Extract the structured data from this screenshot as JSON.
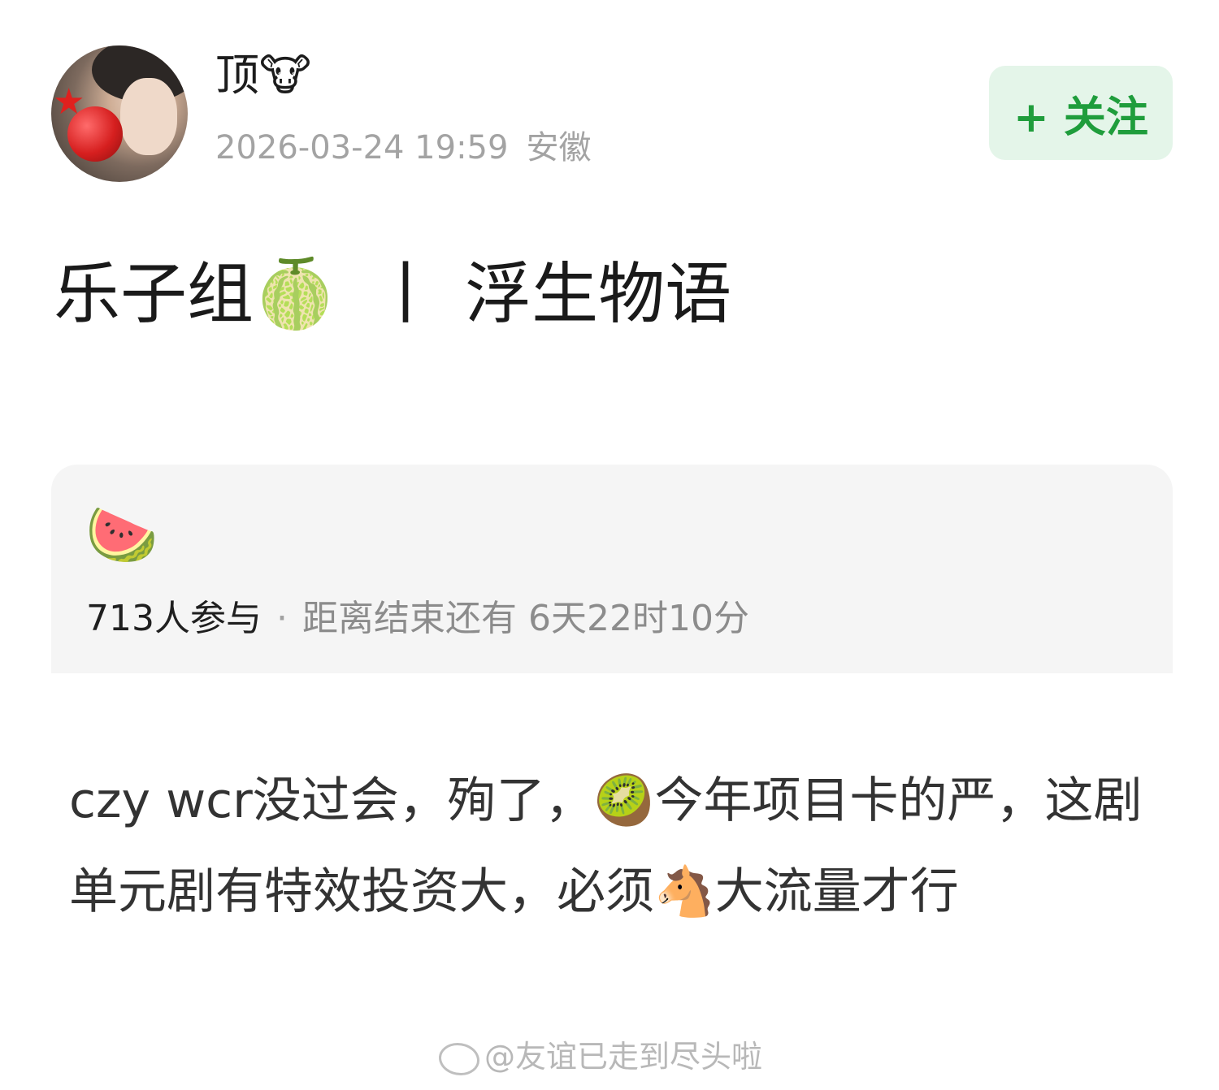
{
  "header": {
    "username": "顶",
    "username_emoji": "🐮",
    "timestamp": "2026-03-24 19:59",
    "location": "安徽",
    "follow_label": "+ 关注"
  },
  "post": {
    "title_left": "乐子组",
    "title_emoji": "🍈",
    "title_separator": "丨",
    "title_right": "浮生物语",
    "body": "czy wcr没过会，殉了，🥝今年项目卡的严，这剧单元剧有特效投资大，必须🐴大流量才行"
  },
  "poll": {
    "emoji": "🍉",
    "participants": "713人参与",
    "separator": "·",
    "deadline": "距离结束还有 6天22时10分"
  },
  "watermark": {
    "text": "@友谊已走到尽头啦"
  },
  "colors": {
    "follow_bg": "#e4f5e9",
    "follow_text": "#1f9d3c",
    "meta_gray": "#a3a3a3",
    "card_bg": "#f5f5f5"
  },
  "icons": {
    "avatar": "user-avatar-photo",
    "watermark_logo": "weibo-logo-icon"
  }
}
